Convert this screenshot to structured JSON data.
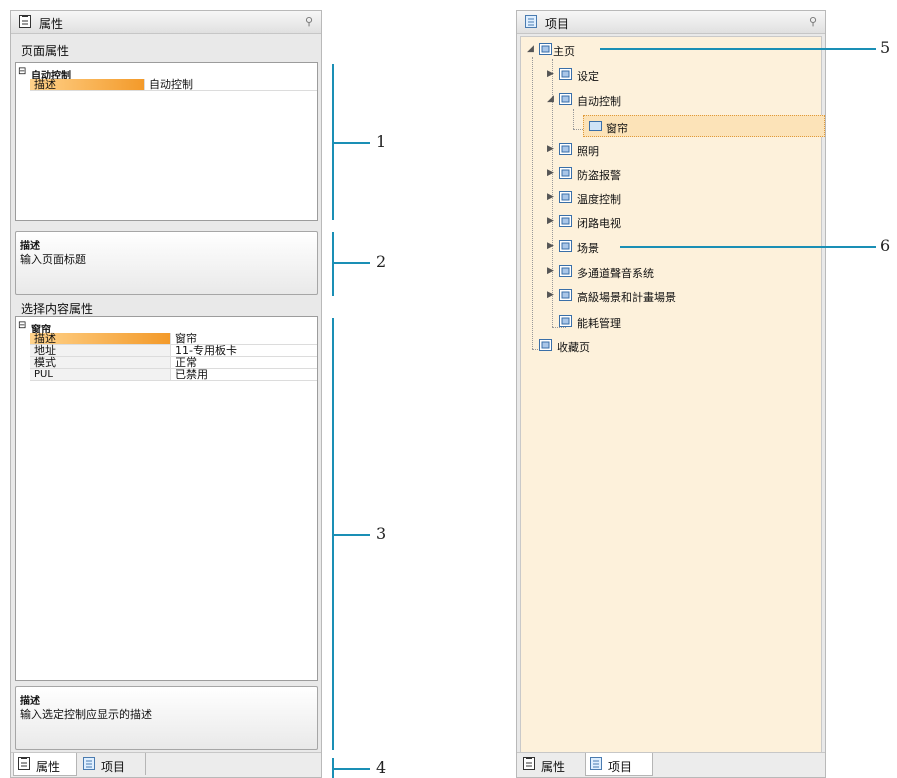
{
  "left_panel": {
    "title": "属性",
    "pin": "⚲",
    "page_props_label": "页面属性",
    "page_grid": {
      "category": "自动控制",
      "expander": "⊟",
      "rows": [
        {
          "name": "描述",
          "value": "自动控制"
        }
      ]
    },
    "page_desc": {
      "title": "描述",
      "text": "输入页面标题"
    },
    "content_props_label": "选择内容属性",
    "content_grid": {
      "category": "窗帘",
      "expander": "⊟",
      "rows": [
        {
          "name": "描述",
          "value": "窗帘"
        },
        {
          "name": "地址",
          "value": "11-专用板卡"
        },
        {
          "name": "模式",
          "value": "正常"
        },
        {
          "name": "PUL",
          "value": "已禁用"
        }
      ]
    },
    "content_desc": {
      "title": "描述",
      "text": "输入选定控制应显示的描述"
    },
    "tabs": [
      {
        "label": "属性",
        "icon": "properties-icon"
      },
      {
        "label": "项目",
        "icon": "project-icon"
      }
    ]
  },
  "right_panel": {
    "title": "项目",
    "pin": "⚲",
    "tree": {
      "root": "主页",
      "children": [
        "设定",
        "自动控制",
        "照明",
        "防盗报警",
        "温度控制",
        "闭路电视",
        "场景",
        "多通道聲音系统",
        "高級場景和計畫場景",
        "能耗管理"
      ],
      "selected_child": "窗帘",
      "second_root": "收藏页"
    },
    "tabs": [
      {
        "label": "属性",
        "icon": "properties-icon"
      },
      {
        "label": "项目",
        "icon": "project-icon"
      }
    ]
  },
  "callouts": [
    "1",
    "2",
    "3",
    "4",
    "5",
    "6"
  ],
  "colors": {
    "accent_line": "#1a8fb5",
    "tree_bg": "#fdf1db",
    "selection": "#f39a2a"
  }
}
